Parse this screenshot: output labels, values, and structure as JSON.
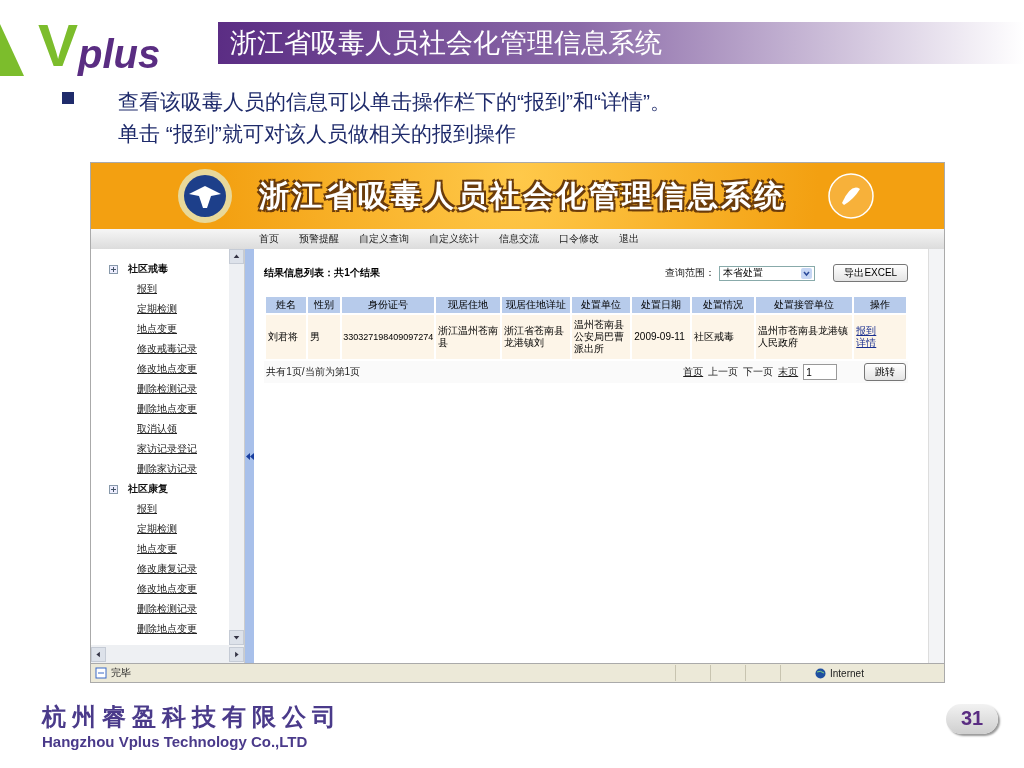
{
  "slide": {
    "logo_initial": "V",
    "logo_rest": "plus",
    "title": "浙江省吸毒人员社会化管理信息系统",
    "bullet_lines": [
      "查看该吸毒人员的信息可以单击操作栏下的“报到”和“详情”。",
      "单击 “报到”就可对该人员做相关的报到操作"
    ]
  },
  "browser": {
    "banner_title": "浙江省吸毒人员社会化管理信息系统",
    "nav": [
      "首页",
      "预警提醒",
      "自定义查询",
      "自定义统计",
      "信息交流",
      "口令修改",
      "退出"
    ],
    "sidebar": [
      {
        "label": "社区戒毒",
        "children": [
          {
            "label": "报到"
          },
          {
            "label": "定期检测"
          },
          {
            "label": "地点变更"
          },
          {
            "label": "修改戒毒记录"
          },
          {
            "label": "修改地点变更"
          },
          {
            "label": "删除检测记录"
          },
          {
            "label": "删除地点变更"
          },
          {
            "label": "取消认领"
          },
          {
            "label": "家访记录登记"
          },
          {
            "label": "删除家访记录"
          }
        ]
      },
      {
        "label": "社区康复",
        "children": [
          {
            "label": "报到"
          },
          {
            "label": "定期检测"
          },
          {
            "label": "地点变更"
          },
          {
            "label": "修改康复记录"
          },
          {
            "label": "修改地点变更"
          },
          {
            "label": "删除检测记录"
          },
          {
            "label": "删除地点变更"
          }
        ]
      }
    ],
    "results": {
      "heading": "结果信息列表：共1个结果",
      "scope_label": "查询范围：",
      "scope_value": "本省处置",
      "export_button": "导出EXCEL",
      "columns": [
        "姓名",
        "性别",
        "身份证号",
        "现居住地",
        "现居住地详址",
        "处置单位",
        "处置日期",
        "处置情况",
        "处置接管单位",
        "操作"
      ],
      "rows": [
        {
          "cells": [
            "刘君将",
            "男",
            "330327198409097274",
            "浙江温州苍南县",
            "浙江省苍南县龙港镇刘",
            "温州苍南县公安局巴曹派出所",
            "2009-09-11",
            "社区戒毒",
            "温州市苍南县龙港镇人民政府"
          ],
          "actions": [
            "报到",
            "详情"
          ]
        }
      ],
      "page_info": "共有1页/当前为第1页",
      "pager": [
        {
          "label": "首页",
          "disabled": false
        },
        {
          "label": "上一页",
          "disabled": true
        },
        {
          "label": "下一页",
          "disabled": true
        },
        {
          "label": "末页",
          "disabled": false
        }
      ],
      "page_input": "1",
      "go_button": "跳转"
    },
    "status_bar": {
      "text": "完毕",
      "zone": "Internet"
    }
  },
  "footer": {
    "company_cn": "杭州睿盈科技有限公司",
    "company_en": "Hangzhou Vplus Technology Co.,LTD",
    "page_number": "31"
  }
}
